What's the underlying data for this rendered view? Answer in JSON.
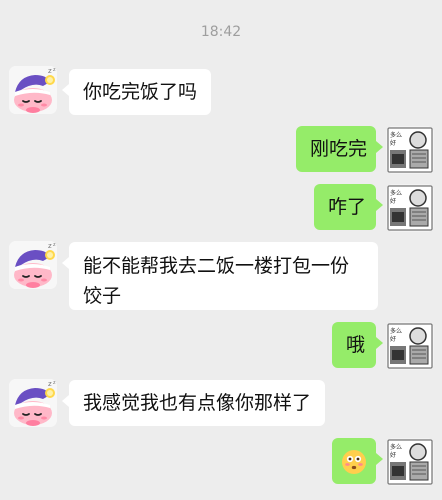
{
  "time": "18:42",
  "messages": [
    {
      "side": "left",
      "text": "你吃完饭了吗"
    },
    {
      "side": "right",
      "text": "刚吃完"
    },
    {
      "side": "right",
      "text": "咋了"
    },
    {
      "side": "left",
      "text": "能不能帮我去二饭一楼打包一份饺子"
    },
    {
      "side": "right",
      "text": "哦"
    },
    {
      "side": "left",
      "text": "我感觉我也有点像你那样了"
    },
    {
      "side": "right",
      "emoji": "flushed-face"
    }
  ],
  "colors": {
    "background": "#ededed",
    "incoming_bubble": "#ffffff",
    "outgoing_bubble": "#95ec69",
    "timestamp": "#9e9e9e"
  },
  "avatars": {
    "left": "sleeping-pink-character-with-nightcap",
    "right": "manga-panel-sticker"
  }
}
